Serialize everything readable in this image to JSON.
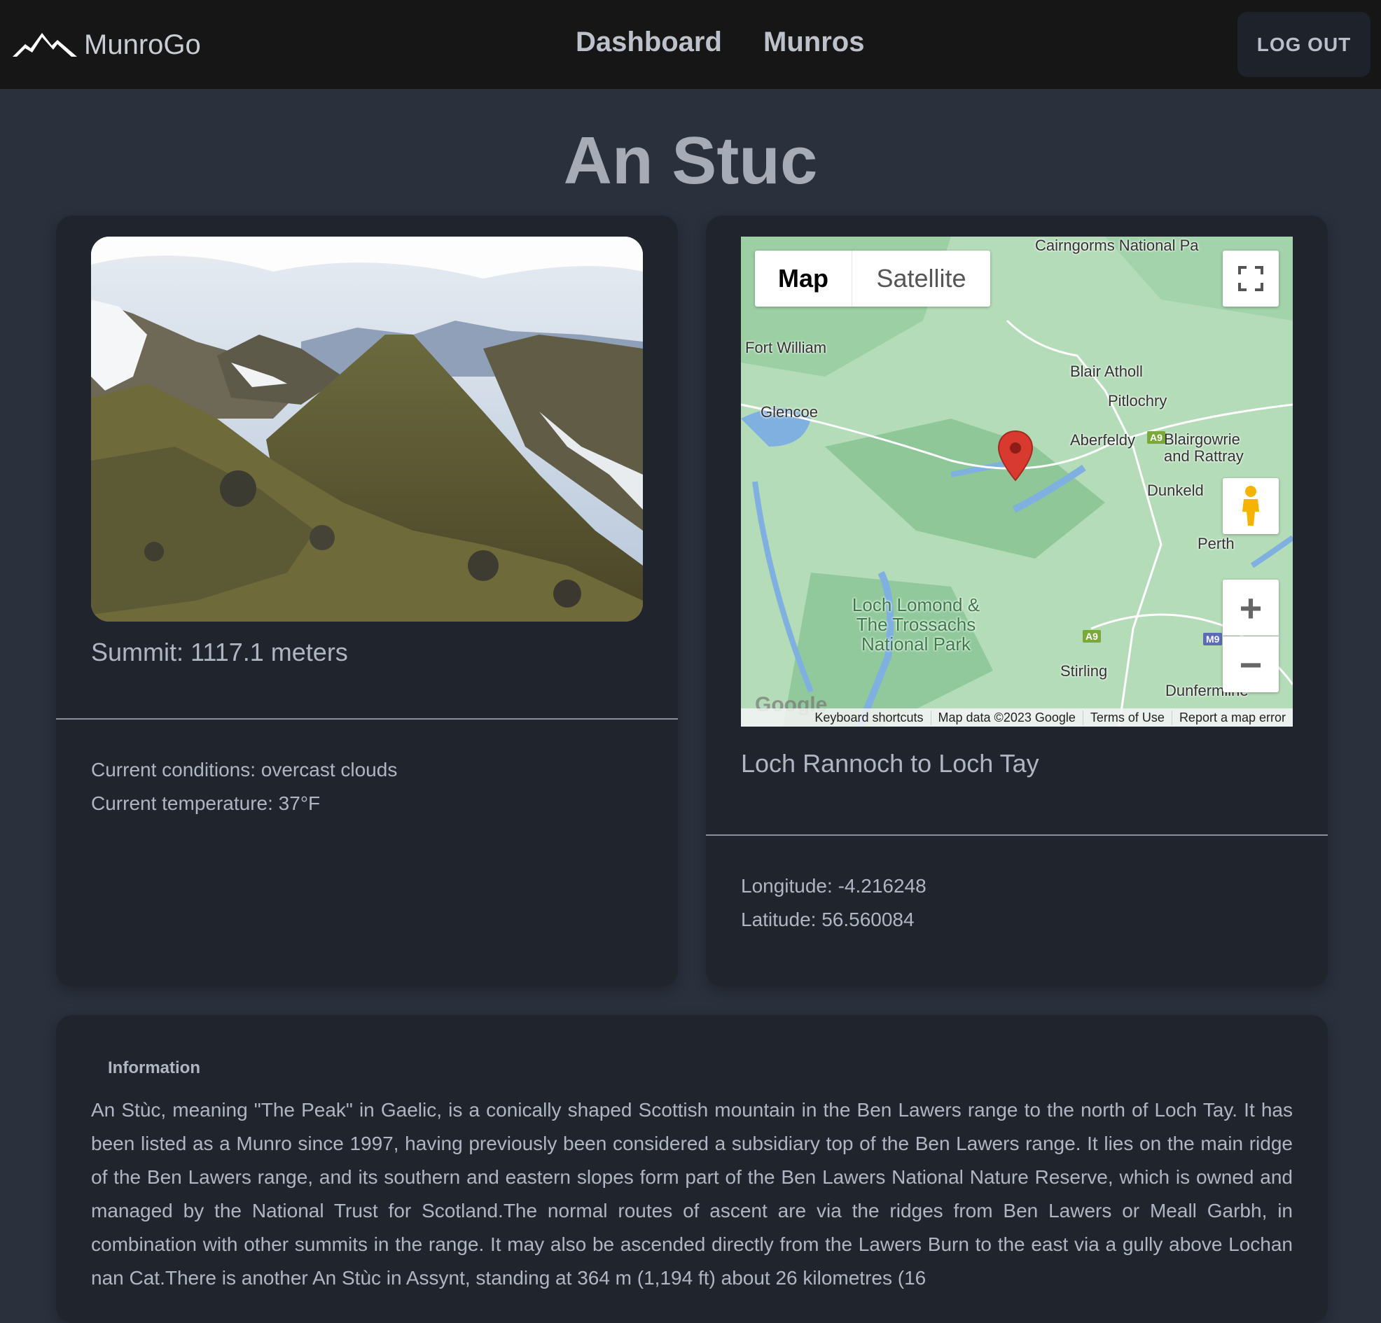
{
  "nav": {
    "brand": "MunroGo",
    "links": [
      "Dashboard",
      "Munros"
    ],
    "logout_label": "LOG OUT"
  },
  "munro": {
    "name": "An Stuc",
    "summit": "Summit: 1117.1 meters",
    "conditions": "Current conditions: overcast clouds",
    "temperature": "Current temperature: 37°F",
    "route": "Loch Rannoch to Loch Tay",
    "longitude": "Longitude: -4.216248",
    "latitude": "Latitude: 56.560084"
  },
  "map": {
    "toggle_map": "Map",
    "toggle_satellite": "Satellite",
    "labels": [
      "Cairngorms National Pa",
      "Fort William",
      "Blair Atholl",
      "Pitlochry",
      "Glencoe",
      "Aberfeldy",
      "Blairgowrie and Rattray",
      "Dunkeld",
      "Perth",
      "Loch Lomond & The Trossachs National Park",
      "Stirling",
      "Dunfermline"
    ],
    "road_shields": [
      "A9",
      "A9",
      "M9"
    ],
    "attribution": [
      "Keyboard shortcuts",
      "Map data ©2023 Google",
      "Terms of Use",
      "Report a map error"
    ],
    "logo": "Google",
    "icons": [
      "fullscreen-icon",
      "pegman-icon",
      "zoom-in-icon",
      "zoom-out-icon",
      "map-pin-icon"
    ]
  },
  "info": {
    "heading": "Information",
    "text": "An Stùc, meaning \"The Peak\" in Gaelic, is a conically shaped Scottish mountain in the Ben Lawers range to the north of Loch Tay. It has been listed as a Munro since 1997, having previously been considered a subsidiary top of the Ben Lawers range. It lies on the main ridge of the Ben Lawers range, and its southern and eastern slopes form part of the Ben Lawers National Nature Reserve, which is owned and managed by the National Trust for Scotland.The normal routes of ascent are via the ridges from Ben Lawers or Meall Garbh, in combination with other summits in the range. It may also be ascended directly from the Lawers Burn to the east via a gully above Lochan nan Cat.There is another An Stùc in Assynt, standing at 364 m (1,194 ft) about 26 kilometres (16"
  },
  "colors": {
    "page_bg": "#2a303c",
    "card_bg": "#20242d",
    "navbar_bg": "#161616",
    "pin": "#d93a2f"
  }
}
